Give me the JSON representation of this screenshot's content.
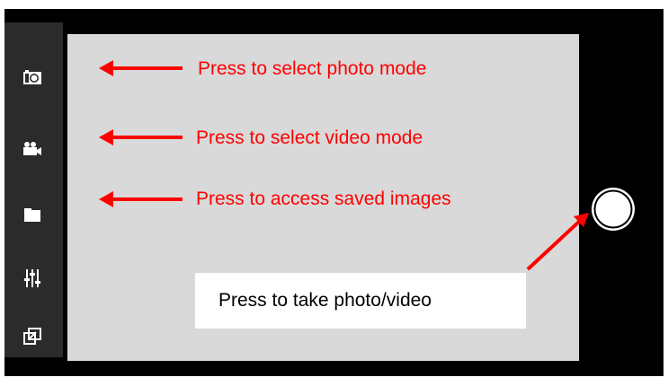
{
  "sidebar": {
    "items": [
      {
        "icon": "camera-icon"
      },
      {
        "icon": "video-camera-icon"
      },
      {
        "icon": "folder-icon"
      },
      {
        "icon": "sliders-icon"
      },
      {
        "icon": "external-window-icon"
      }
    ]
  },
  "annotations": {
    "photo_mode": "Press to select photo mode",
    "video_mode": "Press to select video mode",
    "saved_images": "Press to access saved images",
    "take_photo": "Press to take photo/video"
  },
  "colors": {
    "annotation": "#ff0000",
    "frame": "#000000",
    "sidebar": "#2b2b2b",
    "viewfinder": "#d9d9d9"
  }
}
